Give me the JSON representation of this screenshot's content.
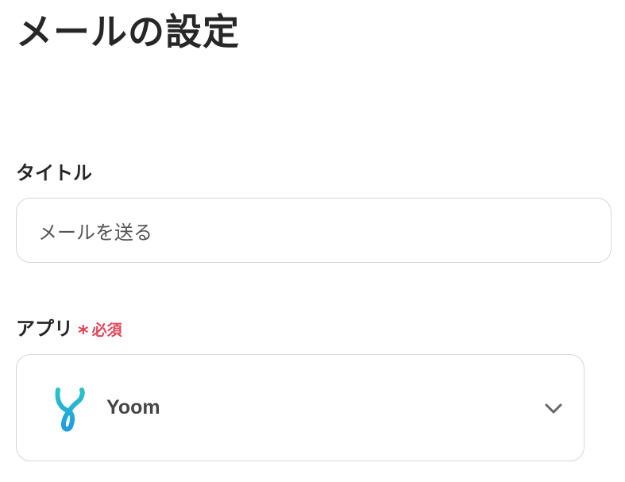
{
  "page": {
    "title": "メールの設定"
  },
  "form": {
    "title_field": {
      "label": "タイトル",
      "value": "メールを送る"
    },
    "app_field": {
      "label": "アプリ",
      "required_marker": "*",
      "required_text": "必須",
      "selected_value": "Yoom",
      "selected_icon": "yoom-logo-icon"
    }
  },
  "colors": {
    "required": "#e0475a",
    "logo_teal": "#2bc3c6",
    "logo_blue": "#1f9de0",
    "border": "#d6d6d6"
  }
}
